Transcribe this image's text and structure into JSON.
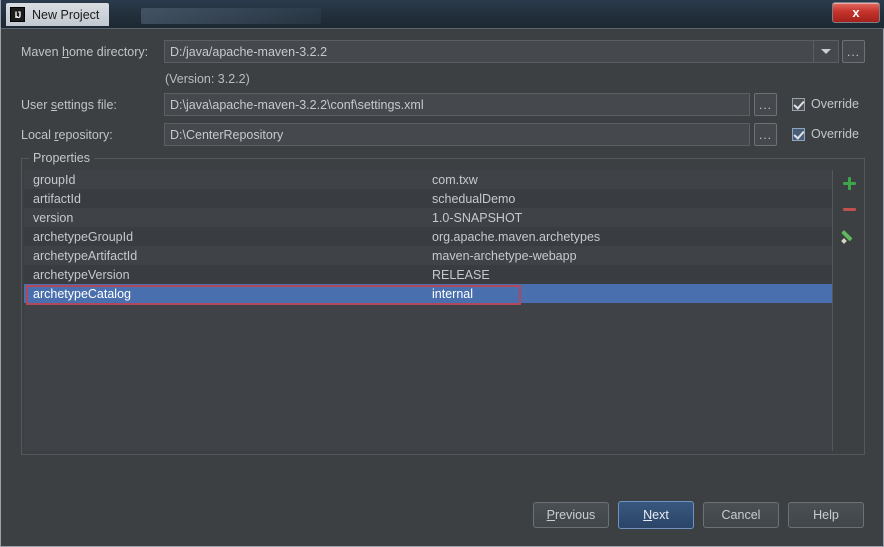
{
  "window": {
    "title": "New Project",
    "app_icon": "intellij-idea-icon",
    "close_label": "x"
  },
  "form": {
    "maven_home": {
      "label_pre": "Maven ",
      "label_mnemonic": "h",
      "label_post": "ome directory:",
      "value": "D:/java/apache-maven-3.2.2",
      "browse_label": "...",
      "dropdown_icon": "chevron-down-icon"
    },
    "version_note": "(Version: 3.2.2)",
    "user_settings": {
      "label_pre": "User ",
      "label_mnemonic": "s",
      "label_post": "ettings file:",
      "value": "D:\\java\\apache-maven-3.2.2\\conf\\settings.xml",
      "browse_label": "...",
      "override_label": "Override",
      "override_checked": true
    },
    "local_repository": {
      "label_pre": "Local ",
      "label_mnemonic": "r",
      "label_post": "epository:",
      "value": "D:\\CenterRepository",
      "browse_label": "...",
      "override_label": "Override",
      "override_checked": true
    }
  },
  "properties": {
    "group_title": "Properties",
    "rows": [
      {
        "key": "groupId",
        "value": "com.txw"
      },
      {
        "key": "artifactId",
        "value": "schedualDemo"
      },
      {
        "key": "version",
        "value": "1.0-SNAPSHOT"
      },
      {
        "key": "archetypeGroupId",
        "value": "org.apache.maven.archetypes"
      },
      {
        "key": "archetypeArtifactId",
        "value": "maven-archetype-webapp"
      },
      {
        "key": "archetypeVersion",
        "value": "RELEASE"
      },
      {
        "key": "archetypeCatalog",
        "value": "internal"
      }
    ],
    "selected_row_index": 6,
    "actions": [
      {
        "name": "add-property-button",
        "icon": "plus-icon"
      },
      {
        "name": "remove-property-button",
        "icon": "minus-icon"
      },
      {
        "name": "edit-property-button",
        "icon": "pencil-icon"
      }
    ]
  },
  "footer": {
    "previous": {
      "pre": "",
      "mnemonic": "P",
      "post": "revious"
    },
    "next": {
      "pre": "",
      "mnemonic": "N",
      "post": "ext"
    },
    "cancel": {
      "label": "Cancel"
    },
    "help": {
      "label": "Help"
    }
  },
  "colors": {
    "background": "#3c4043",
    "selection_blue": "#4a6fae",
    "annotation_red": "#b0475a",
    "default_button_blue": "#2b4468",
    "close_red": "#c5332b"
  }
}
